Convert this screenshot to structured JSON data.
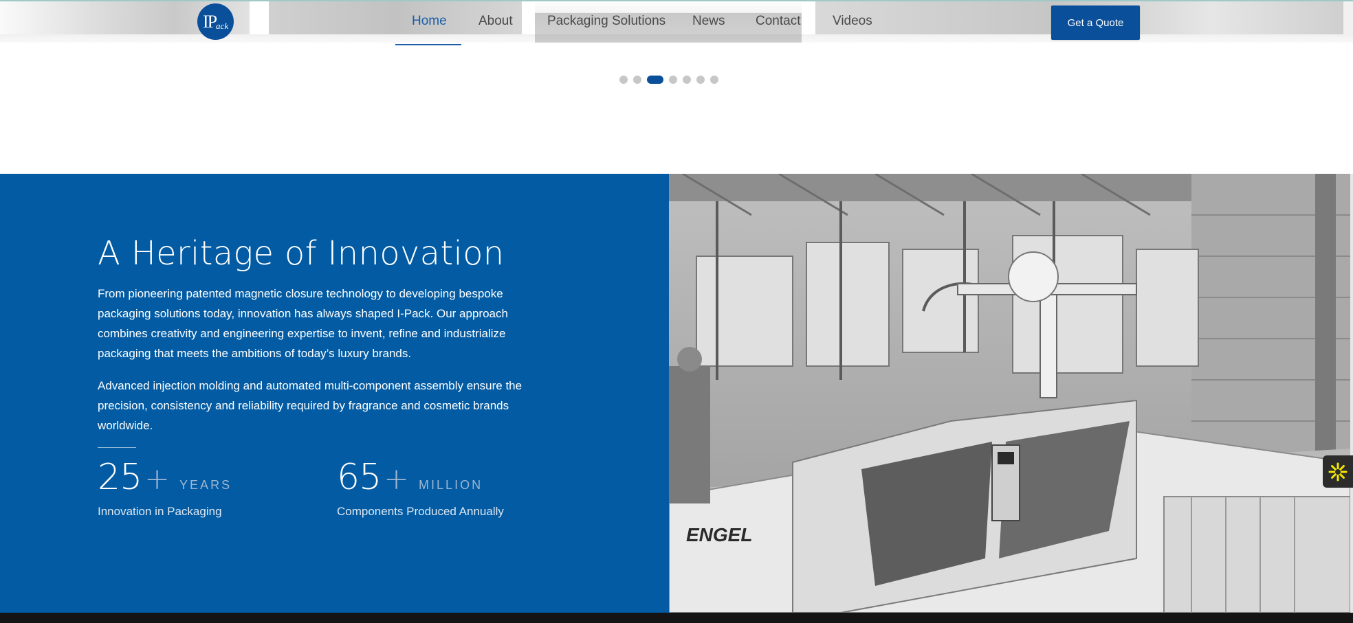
{
  "header": {
    "logo_text": "IPack",
    "nav": [
      {
        "label": "Home",
        "active": true
      },
      {
        "label": "About",
        "active": false
      },
      {
        "label": "Packaging Solutions",
        "active": false
      },
      {
        "label": "News",
        "active": false
      },
      {
        "label": "Contact",
        "active": false
      },
      {
        "label": "Videos",
        "active": false
      }
    ],
    "cta_label": "Get a Quote"
  },
  "carousel": {
    "slide_count": 7,
    "active_slide": 3
  },
  "heritage": {
    "title": "A Heritage of Innovation",
    "paragraph_1": "From pioneering patented magnetic closure technology to developing bespoke packaging solutions today, innovation has always shaped I-Pack. Our approach combines creativity and engineering expertise to invent, refine and industrialize packaging that meets the ambitions of today’s luxury brands.",
    "paragraph_2": "Advanced injection molding and automated multi-component assembly ensure the precision, consistency and reliability required by fragrance and cosmetic brands worldwide.",
    "stats": [
      {
        "number": "25",
        "plus": "+",
        "unit": "YEARS",
        "label": "Innovation in Packaging"
      },
      {
        "number": "65",
        "plus": "+",
        "unit": "MILLION",
        "label": "Components Produced Annually"
      }
    ]
  },
  "factory_image": {
    "machine_brand": "ENGEL"
  },
  "colors": {
    "brand_blue": "#025ba3",
    "nav_active": "#1a5ea8",
    "button_blue": "#0a4f9a",
    "dot_inactive": "#c7c7c7",
    "widget_accent": "#f5e800"
  }
}
